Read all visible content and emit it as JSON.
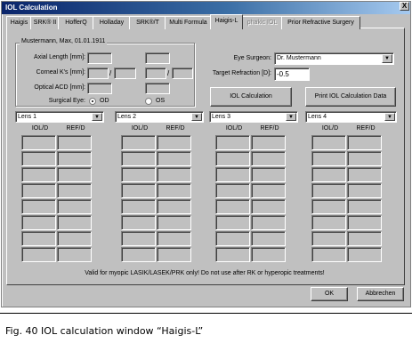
{
  "window": {
    "title": "IOL Calculation",
    "close_glyph": "X"
  },
  "tabs": [
    {
      "label": "Haigis",
      "disabled": false
    },
    {
      "label": "SRK® II",
      "disabled": false
    },
    {
      "label": "HofferQ",
      "disabled": false
    },
    {
      "label": "Holladay",
      "disabled": false
    },
    {
      "label": "SRK®/T",
      "disabled": false
    },
    {
      "label": "Multi Formula",
      "disabled": false
    },
    {
      "label": "Haigis-L",
      "disabled": false,
      "active": true
    },
    {
      "label": "phakic IOL",
      "disabled": true
    },
    {
      "label": "Prior Refractive Surgery",
      "disabled": false
    }
  ],
  "patient": {
    "group_label": "Mustermann, Max, 01.01.1911",
    "axial_length_label": "Axial Length [mm]:",
    "corneal_k_label": "Corneal K's [mm]:",
    "corneal_k_sep": "/",
    "optical_acd_label": "Optical ACD [mm]:",
    "surgical_eye_label": "Surgical Eye:",
    "od_label": "OD",
    "os_label": "OS",
    "selected_eye": "OD"
  },
  "surgeon": {
    "eye_surgeon_label": "Eye Surgeon:",
    "eye_surgeon_value": "Dr. Mustermann",
    "target_refraction_label": "Target Refraction [D]:",
    "target_refraction_value": "-0.5"
  },
  "actions": {
    "iol_calculation": "IOL Calculation",
    "print": "Print IOL Calculation Data"
  },
  "lenses": [
    {
      "label": "Lens 1"
    },
    {
      "label": "Lens 2"
    },
    {
      "label": "Lens 3"
    },
    {
      "label": "Lens 4"
    }
  ],
  "columns": {
    "iol": "IOL/D",
    "ref": "REF/D"
  },
  "note": "Valid for myopic LASIK/LASEK/PRK only! Do not use after RK or hyperopic treatments!",
  "footer": {
    "ok": "OK",
    "cancel": "Abbrechen"
  },
  "caption": "Fig. 40   IOL calculation window “Haigis-L”",
  "icons": {
    "dropdown": "chevron-down-icon"
  }
}
